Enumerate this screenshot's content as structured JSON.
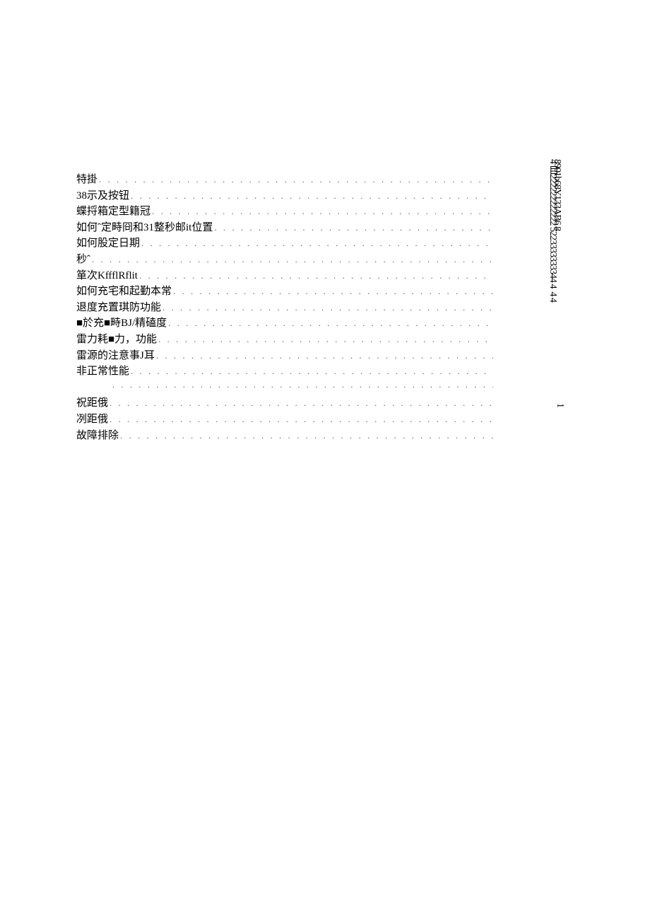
{
  "toc": {
    "entries": [
      {
        "label": "特掛"
      },
      {
        "label": "38示及按钮"
      },
      {
        "label": "蝶捋箱定型籍冠"
      },
      {
        "label": "如何ˆ定畤冏和31整秒邮it位置"
      },
      {
        "label": "如何股定日期"
      },
      {
        "label": "秒ˆ"
      },
      {
        "label": "箪次KffflRflit"
      },
      {
        "label": "如何充宅和起勤本常"
      },
      {
        "label": "退度充置琪防功能"
      },
      {
        "label": "■於充■畤BJ/精磕度"
      },
      {
        "label": "雷力耗■力，功能"
      },
      {
        "label": "雷源的注意事J耳"
      },
      {
        "label": "非正常性能"
      },
      {
        "label": ""
      },
      {
        "label": "祝距俄"
      },
      {
        "label": "冽距俄"
      },
      {
        "label": "故障排除"
      }
    ]
  },
  "side_text_1": "4 目222222222222 5223333333344 4  4 4",
  "side_text_2": "8901b68Y133AB6 8",
  "page_number": "1"
}
